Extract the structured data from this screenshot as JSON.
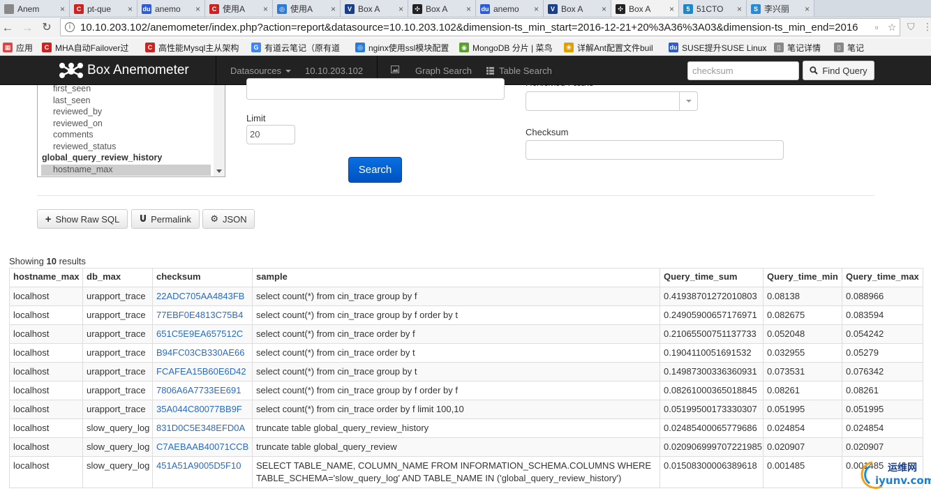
{
  "browser": {
    "tabs": [
      {
        "title": "Anem",
        "color": "#888888",
        "glyph": "",
        "active": false
      },
      {
        "title": "pt-que",
        "color": "#cc2222",
        "glyph": "C",
        "active": false
      },
      {
        "title": "anemo",
        "color": "#2e5bd6",
        "glyph": "du",
        "active": false
      },
      {
        "title": "使用A",
        "color": "#cc2222",
        "glyph": "C",
        "active": false
      },
      {
        "title": "使用A",
        "color": "#2e7bd6",
        "glyph": "◎",
        "active": false
      },
      {
        "title": "Box A",
        "color": "#1a3f8a",
        "glyph": "V",
        "active": false
      },
      {
        "title": "Box A",
        "color": "#222222",
        "glyph": "✣",
        "active": false
      },
      {
        "title": "anemo",
        "color": "#2e5bd6",
        "glyph": "du",
        "active": false
      },
      {
        "title": "Box A",
        "color": "#1a3f8a",
        "glyph": "V",
        "active": false
      },
      {
        "title": "Box A",
        "color": "#222222",
        "glyph": "✣",
        "active": true
      },
      {
        "title": "51CTO",
        "color": "#1e88c7",
        "glyph": "5",
        "active": false
      },
      {
        "title": "李兴丽",
        "color": "#2b8ad6",
        "glyph": "S",
        "active": false
      }
    ],
    "url": "10.10.203.102/anemometer/index.php?action=report&datasource=10.10.203.102&dimension-ts_min_start=2016-12-21+20%3A36%3A03&dimension-ts_min_end=2016",
    "bookmarks": [
      {
        "label": "应用",
        "color": "#d44",
        "glyph": "▦"
      },
      {
        "label": "MHA自动Failover过",
        "color": "#cc2222",
        "glyph": "C"
      },
      {
        "label": "高性能Mysql主从架构",
        "color": "#cc2222",
        "glyph": "C"
      },
      {
        "label": "有道云笔记（原有道",
        "color": "#4285f4",
        "glyph": "G"
      },
      {
        "label": "nginx使用ssl模块配置",
        "color": "#2e7bd6",
        "glyph": "◎"
      },
      {
        "label": "MongoDB 分片 | 菜鸟",
        "color": "#5aa02c",
        "glyph": "◉"
      },
      {
        "label": "详解Ant配置文件buil",
        "color": "#e0a000",
        "glyph": "❀"
      },
      {
        "label": "SUSE提升SUSE Linux",
        "color": "#2e5bd6",
        "glyph": "du"
      },
      {
        "label": "笔记详情",
        "color": "#888888",
        "glyph": "▯"
      },
      {
        "label": "笔记",
        "color": "#888888",
        "glyph": "▯"
      }
    ]
  },
  "app": {
    "brand": "Box Anemometer",
    "nav": {
      "datasources": "Datasources",
      "host": "10.10.203.102",
      "graph_search": "Graph Search",
      "table_search": "Table Search",
      "search_placeholder": "checksum",
      "find_query": "Find Query"
    }
  },
  "form": {
    "listbox": {
      "options_before": [
        "first_seen",
        "last_seen",
        "reviewed_by",
        "reviewed_on",
        "comments",
        "reviewed_status"
      ],
      "group": "global_query_review_history",
      "selected": "hostname_max"
    },
    "limit_label": "Limit",
    "limit_value": "20",
    "reviewed_status_label": "Reviewed Status",
    "checksum_label": "Checksum",
    "search_button": "Search",
    "show_raw_sql": "Show Raw SQL",
    "permalink": "Permalink",
    "json": "JSON"
  },
  "results": {
    "showing_prefix": "Showing",
    "count": "10",
    "showing_suffix": "results",
    "columns": [
      "hostname_max",
      "db_max",
      "checksum",
      "sample",
      "Query_time_sum",
      "Query_time_min",
      "Query_time_max"
    ],
    "rows": [
      [
        "localhost",
        "urapport_trace",
        "22ADC705AA4843FB",
        "select count(*) from cin_trace group by f",
        "0.41938701272010803",
        "0.08138",
        "0.088966"
      ],
      [
        "localhost",
        "urapport_trace",
        "77EBF0E4813C75B4",
        "select count(*) from cin_trace group by f order by t",
        "0.24905900657176971",
        "0.082675",
        "0.083594"
      ],
      [
        "localhost",
        "urapport_trace",
        "651C5E9EA657512C",
        "select count(*) from cin_trace order by f",
        "0.21065500751137733",
        "0.052048",
        "0.054242"
      ],
      [
        "localhost",
        "urapport_trace",
        "B94FC03CB330AE66",
        "select count(*) from cin_trace order by t",
        "0.1904110051691532",
        "0.032955",
        "0.05279"
      ],
      [
        "localhost",
        "urapport_trace",
        "FCAFEA15B60E6D42",
        "select count(*) from cin_trace group by t",
        "0.14987300336360931",
        "0.073531",
        "0.076342"
      ],
      [
        "localhost",
        "urapport_trace",
        "7806A6A7733EE691",
        "select count(*) from cin_trace group by f order by f",
        "0.08261000365018845",
        "0.08261",
        "0.08261"
      ],
      [
        "localhost",
        "urapport_trace",
        "35A044C80077BB9F",
        "select count(*) from cin_trace order by f limit 100,10",
        "0.05199500173330307",
        "0.051995",
        "0.051995"
      ],
      [
        "localhost",
        "slow_query_log",
        "831D0C5E348EFD0A",
        "truncate table global_query_review_history",
        "0.02485400065779686",
        "0.024854",
        "0.024854"
      ],
      [
        "localhost",
        "slow_query_log",
        "C7AEBAAB40071CCB",
        "truncate table global_query_review",
        "0.020906999707221985",
        "0.020907",
        "0.020907"
      ],
      [
        "localhost",
        "slow_query_log",
        "451A51A9005D5F10",
        "SELECT TABLE_NAME, COLUMN_NAME FROM INFORMATION_SCHEMA.COLUMNS WHERE TABLE_SCHEMA='slow_query_log' AND TABLE_NAME IN ('global_query_review_history')",
        "0.01508300006389618",
        "0.001485",
        "0.001485"
      ]
    ]
  },
  "watermark": {
    "line1": "运维网",
    "line2": "iyunv.com"
  }
}
